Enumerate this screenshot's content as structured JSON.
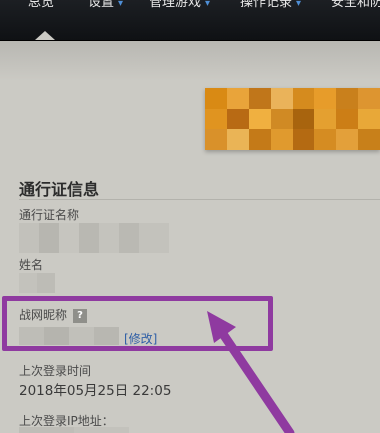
{
  "nav": {
    "items": [
      {
        "label": "总览",
        "has_dropdown": false
      },
      {
        "label": "设置",
        "has_dropdown": true
      },
      {
        "label": "管理游戏",
        "has_dropdown": true
      },
      {
        "label": "操作记录",
        "has_dropdown": true
      },
      {
        "label": "安全和防",
        "has_dropdown": false
      }
    ],
    "chevron": "▾",
    "active": "总览"
  },
  "account": {
    "section_title": "通行证信息",
    "passport_name_label": "通行证名称",
    "name_label": "姓名",
    "battletag_label": "战网昵称",
    "help_icon_glyph": "?",
    "edit_link": "[修改]",
    "last_login_time_label": "上次登录时间",
    "last_login_time": "2018年05月25日 22:05",
    "last_login_ip_label": "上次登录IP地址："
  },
  "annotation": {
    "color": "#8f3aa0"
  },
  "colors": {
    "background": "#cbcac4",
    "nav_bg": "#15181b",
    "link": "#2f5fa6"
  }
}
